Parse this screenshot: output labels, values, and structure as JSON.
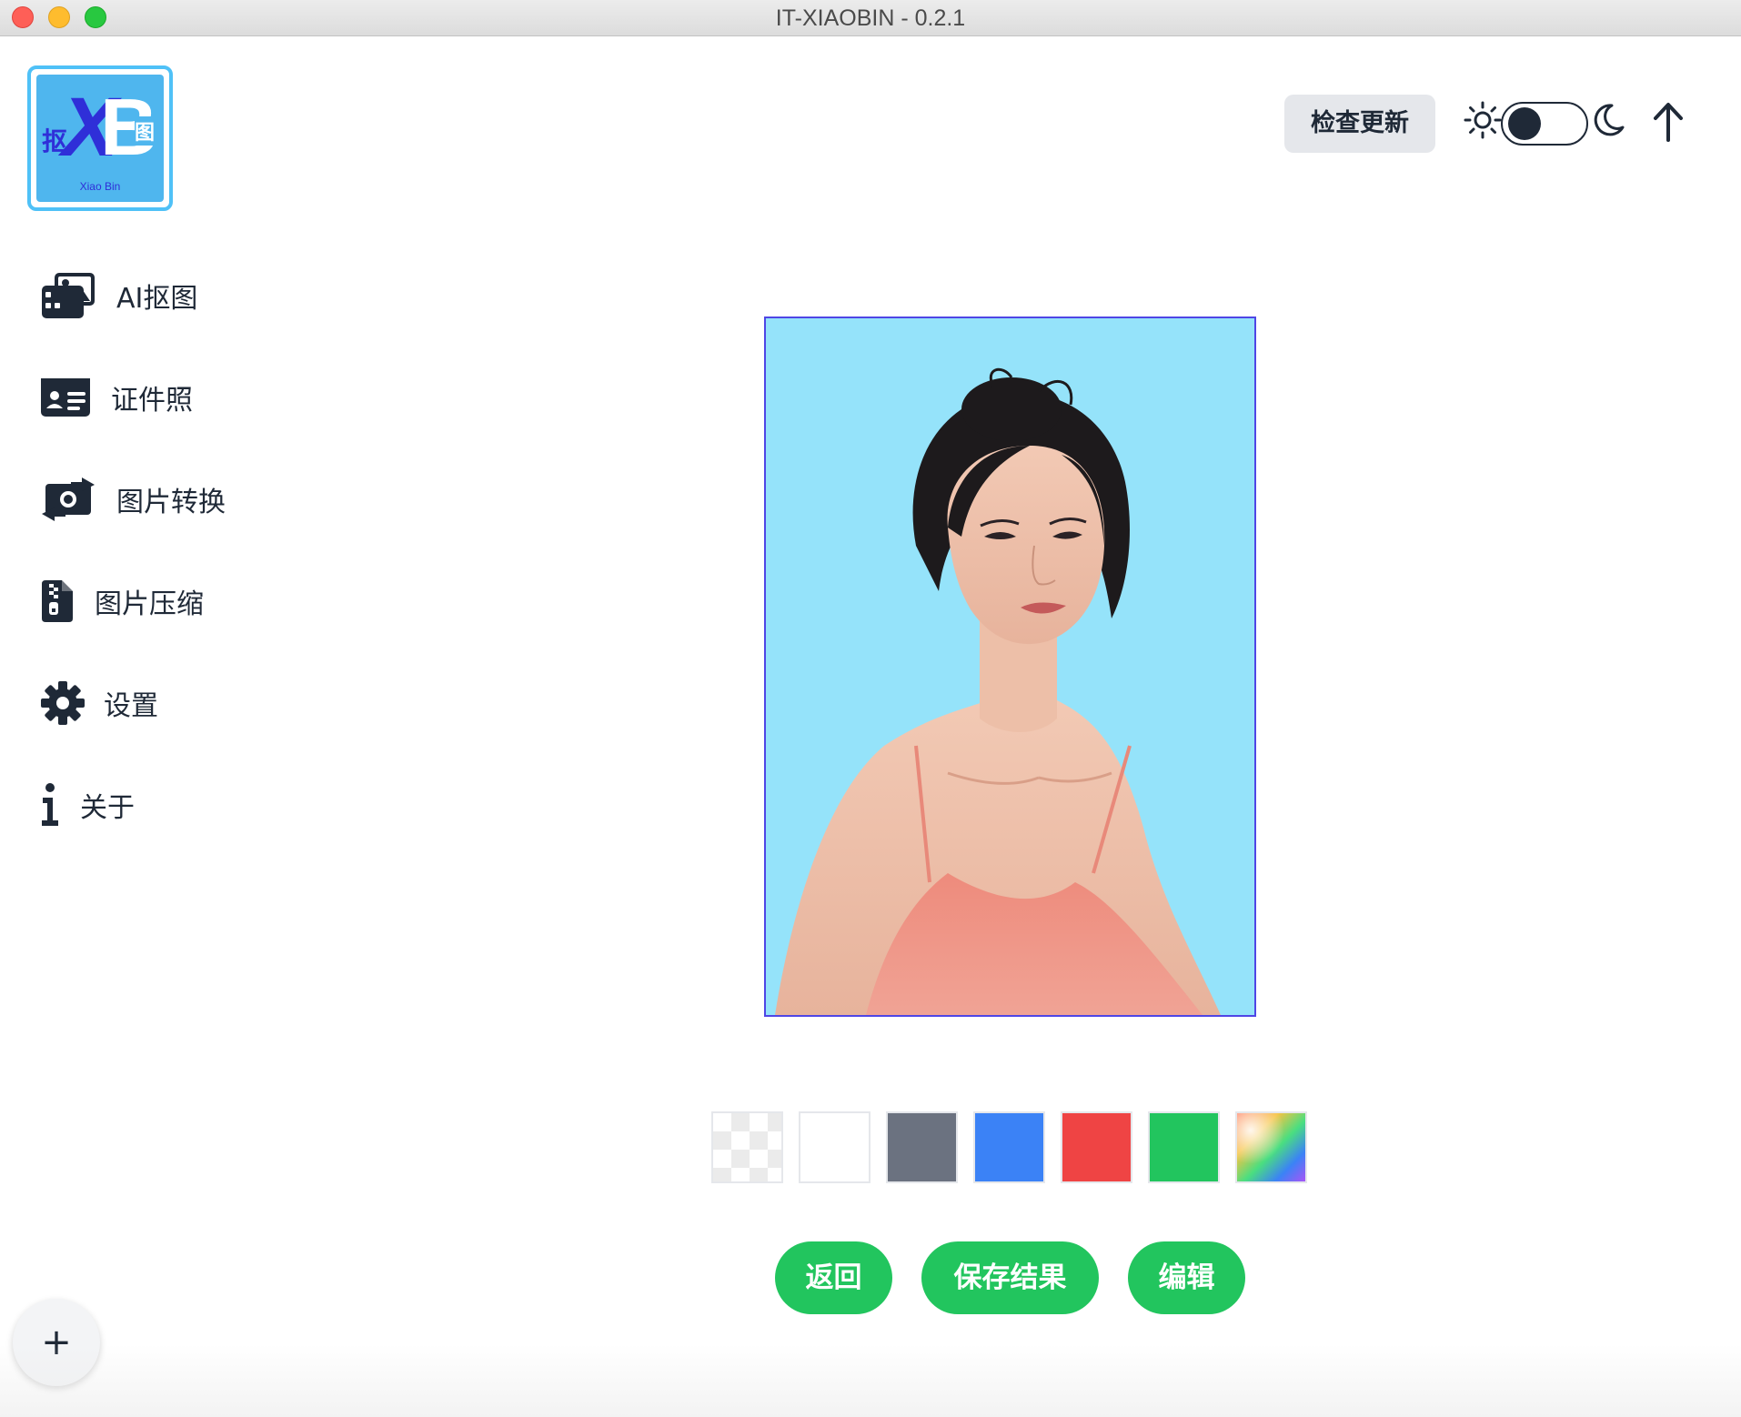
{
  "window": {
    "title": "IT-XIAOBIN - 0.2.1"
  },
  "logo": {
    "letter_x": "X",
    "letter_b": "B",
    "char_left": "抠",
    "char_right": "图",
    "caption": "Xiao Bin"
  },
  "header": {
    "update_button": "检查更新",
    "theme_toggle": {
      "mode": "light",
      "left_icon": "sun-icon",
      "right_icon": "moon-icon"
    },
    "scroll_top_icon": "arrow-up-icon"
  },
  "sidebar": {
    "items": [
      {
        "label": "AI抠图",
        "icon": "images-icon"
      },
      {
        "label": "证件照",
        "icon": "id-card-icon"
      },
      {
        "label": "图片转换",
        "icon": "money-bill-transfer-icon"
      },
      {
        "label": "图片压缩",
        "icon": "file-zipper-icon"
      },
      {
        "label": "设置",
        "icon": "gear-icon"
      },
      {
        "label": "关于",
        "icon": "info-icon"
      }
    ]
  },
  "preview": {
    "background_color": "#95e3fa"
  },
  "swatches": [
    {
      "name": "transparent",
      "color": "transparent"
    },
    {
      "name": "white",
      "color": "#ffffff"
    },
    {
      "name": "gray",
      "color": "#6b7280"
    },
    {
      "name": "blue",
      "color": "#3b82f6"
    },
    {
      "name": "red",
      "color": "#ef4444"
    },
    {
      "name": "green",
      "color": "#22c55e"
    },
    {
      "name": "custom",
      "color": "gradient"
    }
  ],
  "actions": {
    "back": "返回",
    "save": "保存结果",
    "edit": "编辑"
  },
  "fab": {
    "label": "+"
  },
  "colors": {
    "accent": "#22c55e",
    "text": "#1f2937",
    "frame_border": "#4f46e5"
  }
}
